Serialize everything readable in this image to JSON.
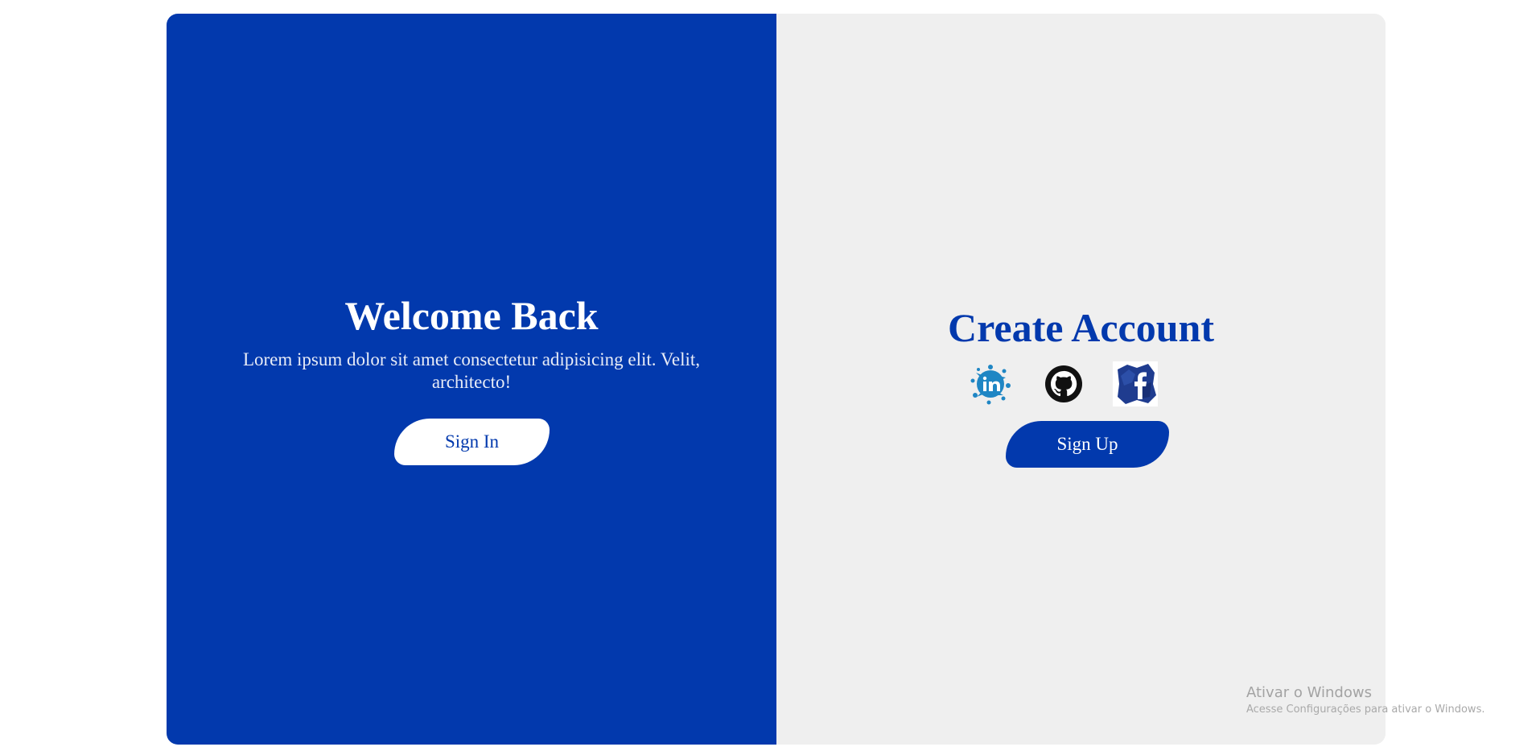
{
  "left_panel": {
    "title": "Welcome Back",
    "description": "Lorem ipsum dolor sit amet consectetur adipisicing elit. Velit, architecto!",
    "signin_label": "Sign In"
  },
  "right_panel": {
    "title": "Create Account",
    "socials": [
      {
        "icon": "linkedin-icon"
      },
      {
        "icon": "github-icon"
      },
      {
        "icon": "facebook-icon"
      }
    ],
    "signup_label": "Sign Up"
  },
  "watermark": {
    "title": "Ativar o Windows",
    "subtitle": "Acesse Configurações para ativar o Windows."
  },
  "colors": {
    "primary": "#0239ad",
    "panel_bg": "#efefef",
    "page_bg": "#ffffff"
  }
}
